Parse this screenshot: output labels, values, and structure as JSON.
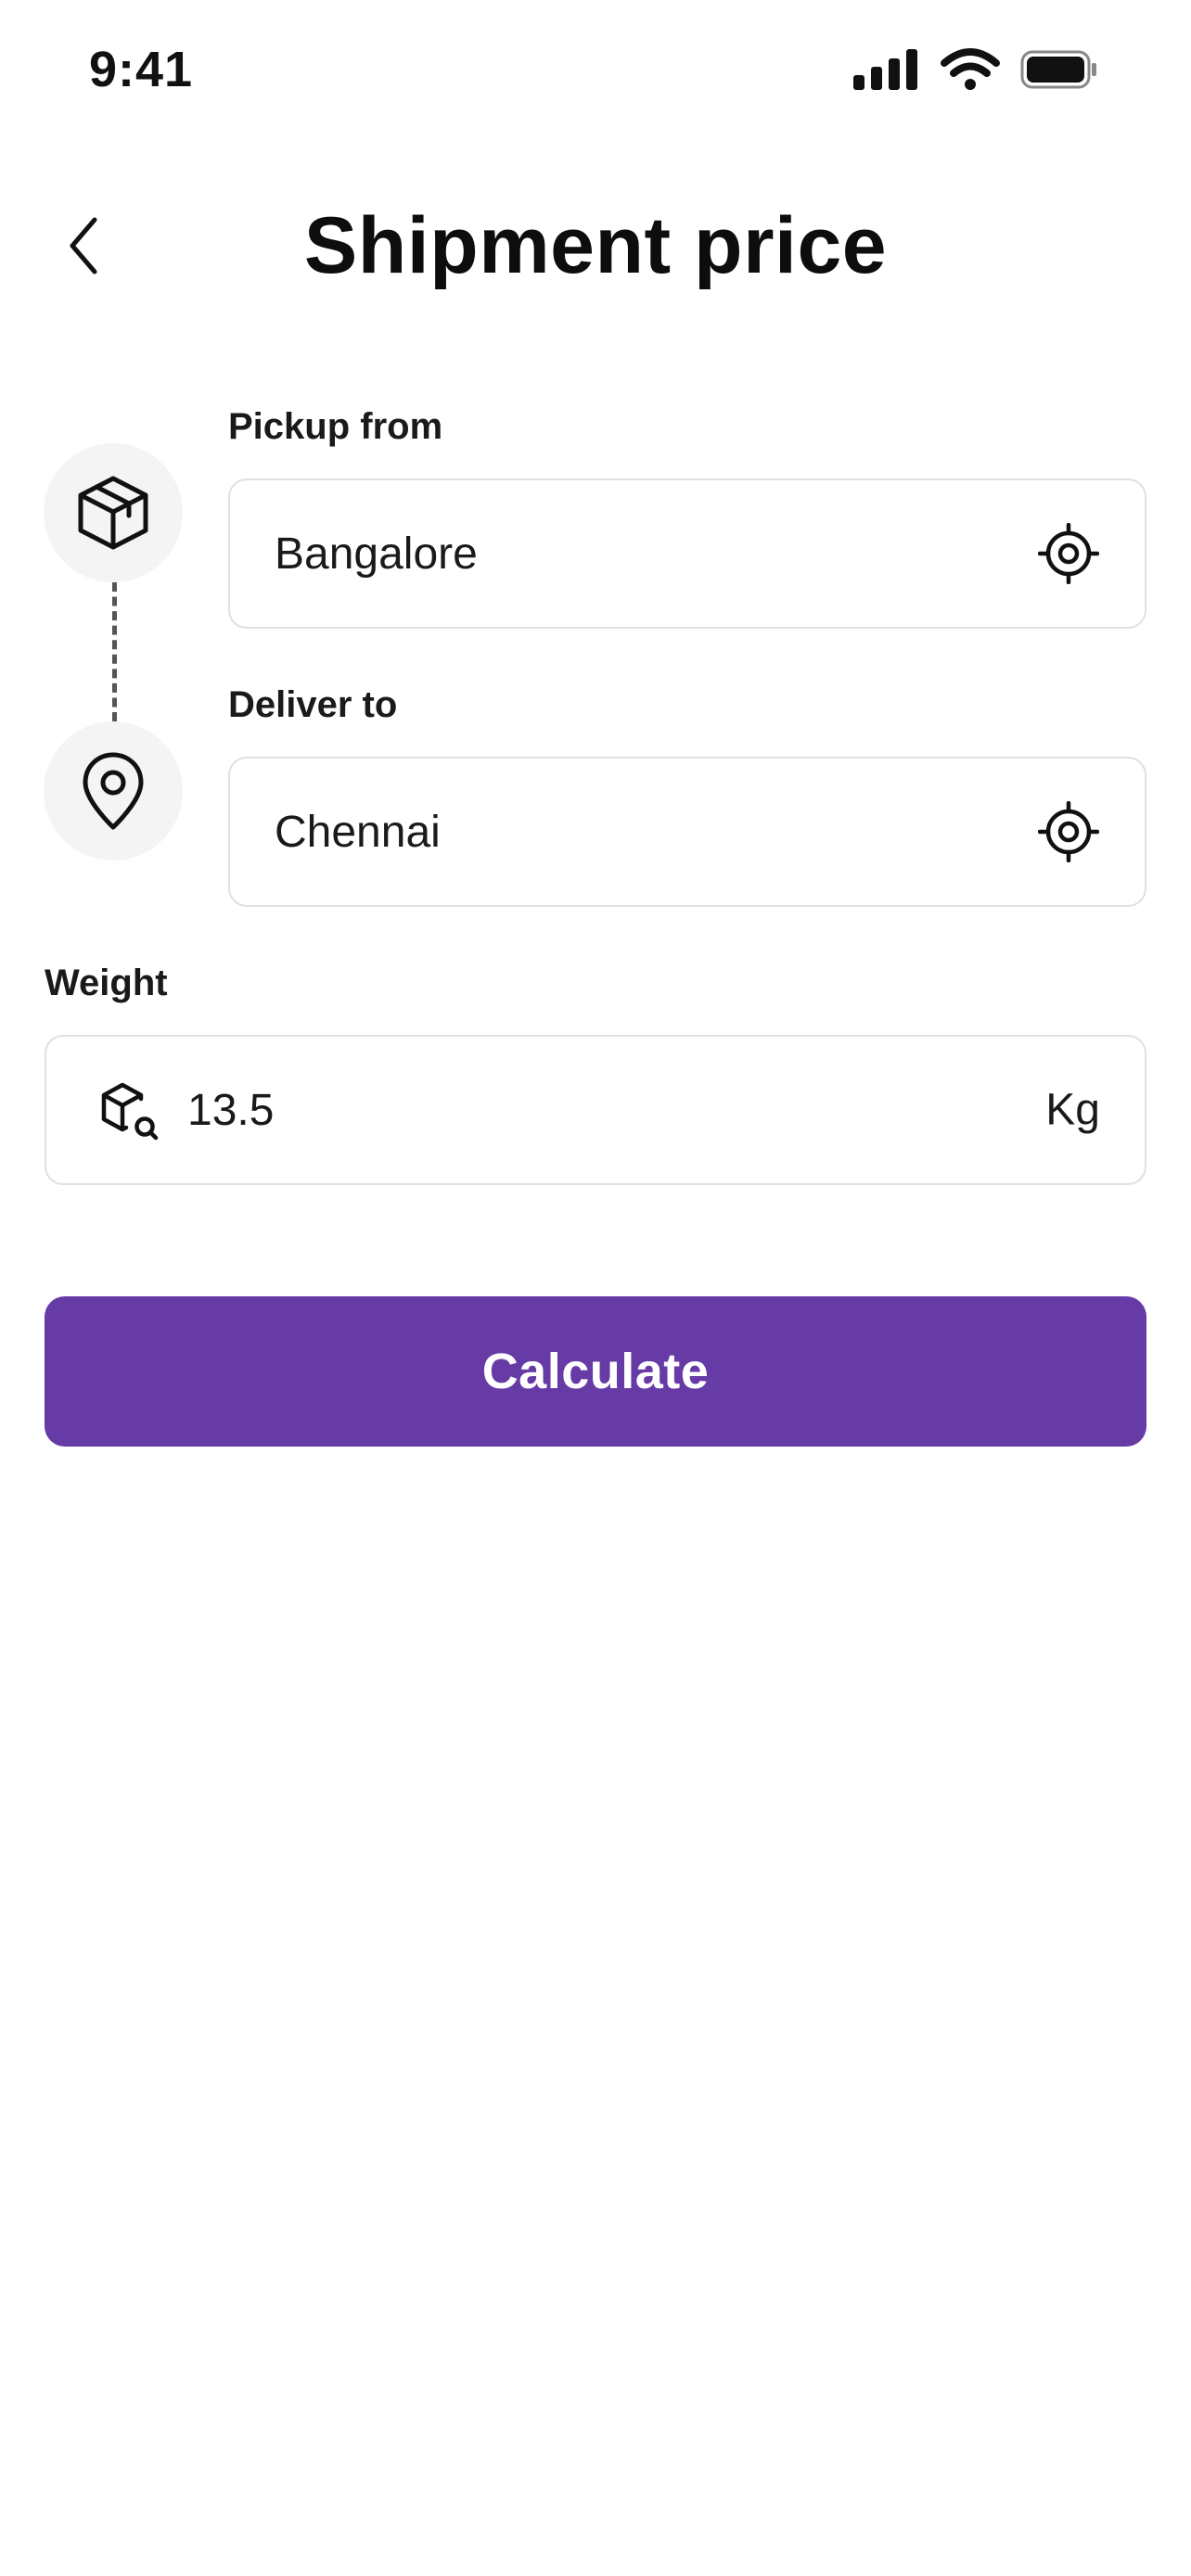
{
  "status_bar": {
    "time": "9:41",
    "icons": [
      "cellular-signal-icon",
      "wifi-icon",
      "battery-icon"
    ]
  },
  "header": {
    "title": "Shipment price",
    "back_icon": "chevron-left-icon"
  },
  "route": {
    "pickup": {
      "label": "Pickup from",
      "value": "Bangalore",
      "icon": "package-box-icon",
      "action_icon": "crosshair-locate-icon"
    },
    "delivery": {
      "label": "Deliver to",
      "value": "Chennai",
      "icon": "map-pin-icon",
      "action_icon": "crosshair-locate-icon"
    }
  },
  "weight": {
    "label": "Weight",
    "value": "13.5",
    "unit": "Kg",
    "icon": "box-search-icon"
  },
  "actions": {
    "calculate_label": "Calculate"
  },
  "colors": {
    "primary": "#673ba6",
    "field_border": "#e0e0e0",
    "icon_circle_bg": "#f4f4f4",
    "text": "#111111"
  }
}
